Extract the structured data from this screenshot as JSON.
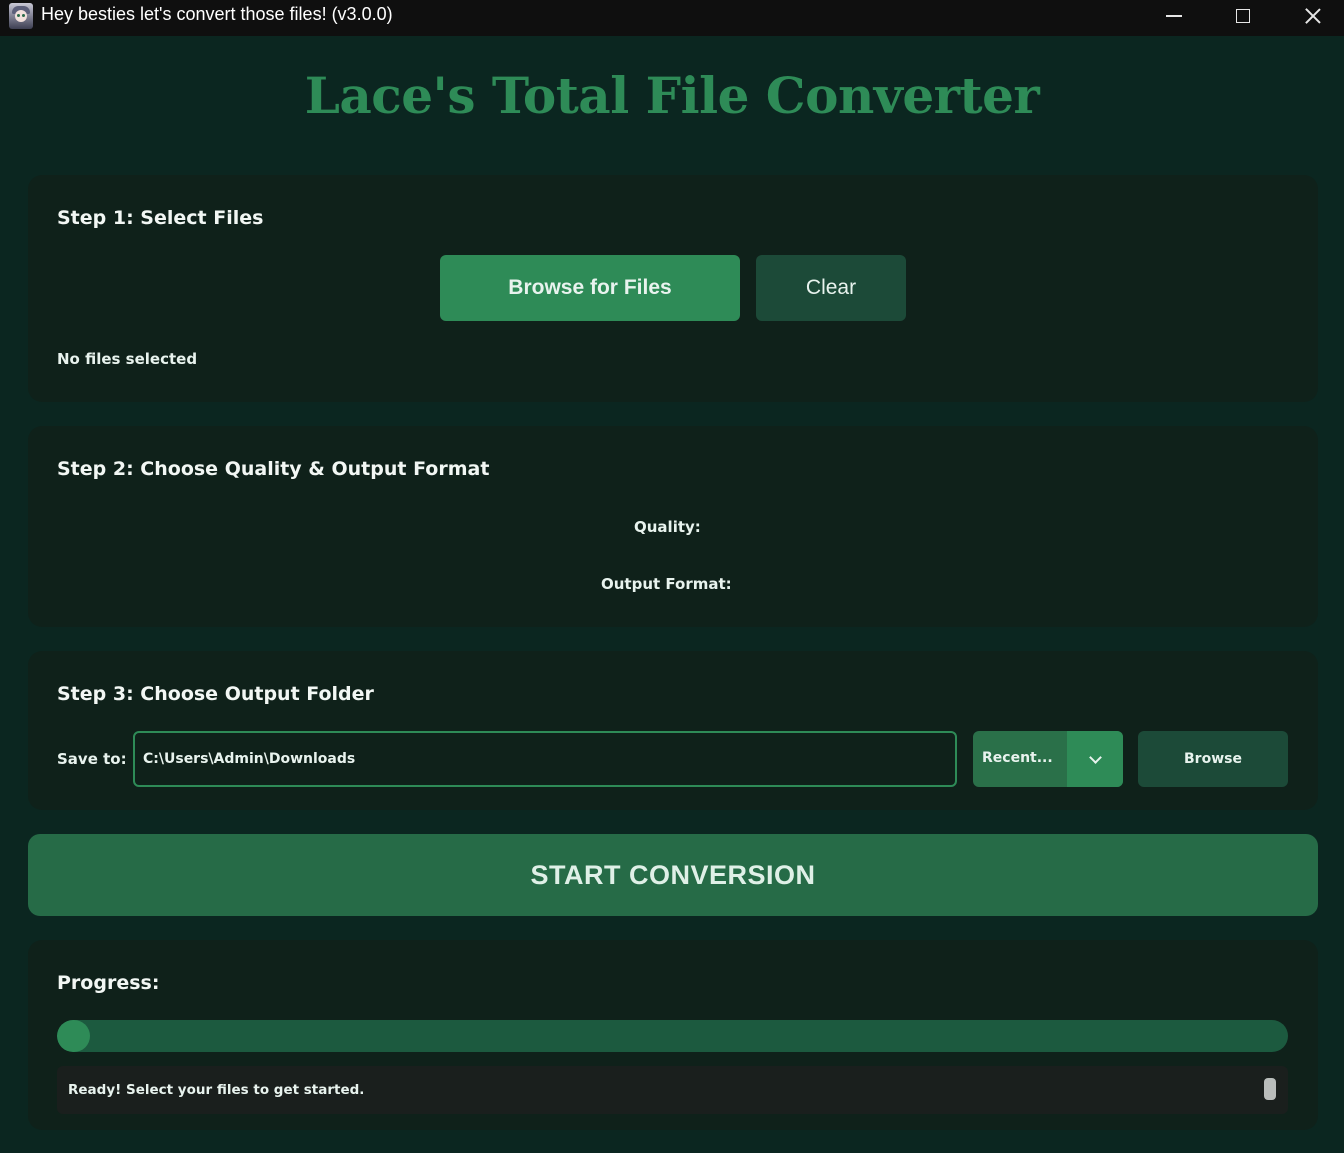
{
  "window": {
    "title": "Hey besties let's convert those files! (v3.0.0)"
  },
  "app": {
    "heading": "Lace's Total File Converter",
    "accent_color": "#2e8b57"
  },
  "step1": {
    "title": "Step 1: Select Files",
    "browse_label": "Browse for Files",
    "clear_label": "Clear",
    "status": "No files selected"
  },
  "step2": {
    "title": "Step 2: Choose Quality & Output Format",
    "quality_label": "Quality:",
    "format_label": "Output Format:"
  },
  "step3": {
    "title": "Step 3: Choose Output Folder",
    "save_to_label": "Save to:",
    "path_value": "C:\\Users\\Admin\\Downloads",
    "recent_label": "Recent...",
    "browse_label": "Browse"
  },
  "start_button": "START CONVERSION",
  "progress": {
    "title": "Progress:",
    "value": 0.027,
    "status_text": "Ready! Select your files to get started."
  }
}
